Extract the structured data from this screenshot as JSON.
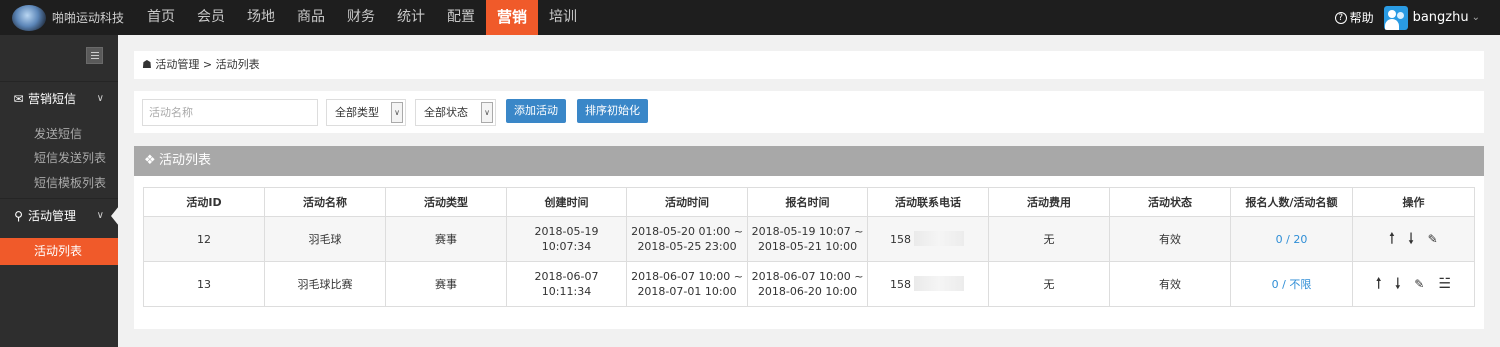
{
  "header": {
    "logo_text": "啪啪运动科技",
    "nav": [
      "首页",
      "会员",
      "场地",
      "商品",
      "财务",
      "统计",
      "配置",
      "营销",
      "培训"
    ],
    "active_nav": "营销",
    "help_label": "帮助",
    "username": "bangzhu",
    "help_icon": "question-circle-icon",
    "user_icon": "users-avatar-icon"
  },
  "sidebar": {
    "section1": {
      "label": "营销短信",
      "icon": "envelope-icon"
    },
    "section1_items": [
      "发送短信",
      "短信发送列表",
      "短信模板列表"
    ],
    "section2": {
      "label": "活动管理",
      "icon": "location-pin-icon"
    },
    "section2_items": [
      "活动列表"
    ]
  },
  "breadcrumb": "活动管理 > 活动列表",
  "filters": {
    "name_placeholder": "活动名称",
    "type_select": "全部类型",
    "status_select": "全部状态",
    "add_button": "添加活动",
    "reset_sort_button": "排序初始化"
  },
  "panel": {
    "title": "活动列表",
    "icon": "tag-icon"
  },
  "table": {
    "columns": [
      "活动ID",
      "活动名称",
      "活动类型",
      "创建时间",
      "活动时间",
      "报名时间",
      "活动联系电话",
      "活动费用",
      "活动状态",
      "报名人数/活动名额",
      "操作"
    ],
    "rows": [
      {
        "id": "12",
        "name": "羽毛球",
        "type": "赛事",
        "created_date": "2018-05-19",
        "created_time": "10:07:34",
        "event_start": "2018-05-20 01:00 ~",
        "event_end": "2018-05-25 23:00",
        "signup_start": "2018-05-19 10:07 ~",
        "signup_end": "2018-05-21 10:00",
        "phone": "158",
        "fee": "无",
        "status": "有效",
        "quota": "0 / 20"
      },
      {
        "id": "13",
        "name": "羽毛球比赛",
        "type": "赛事",
        "created_date": "2018-06-07",
        "created_time": "10:11:34",
        "event_start": "2018-06-07 10:00 ~",
        "event_end": "2018-07-01 10:00",
        "signup_start": "2018-06-07 10:00 ~",
        "signup_end": "2018-06-20 10:00",
        "phone": "158",
        "fee": "无",
        "status": "有效",
        "quota": "0 / 不限"
      }
    ]
  },
  "colors": {
    "accent": "#f05a2a",
    "button": "#3a87c8",
    "link": "#2f8ed6",
    "topbar": "#1e1e1e",
    "sidebar": "#2e2e2e"
  }
}
